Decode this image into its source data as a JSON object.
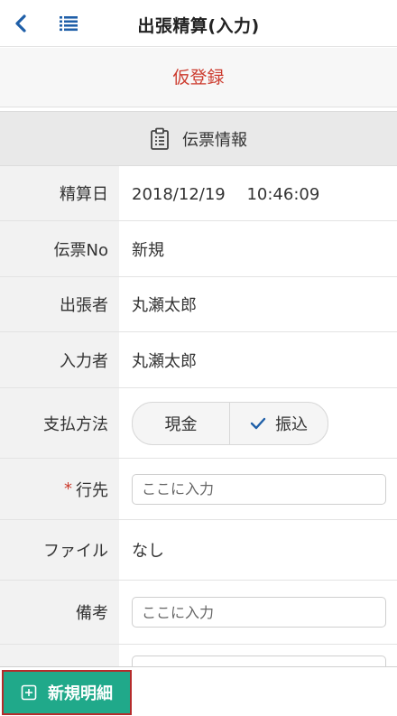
{
  "header": {
    "title": "出張精算(入力)",
    "back_icon": "chevron-left-icon",
    "menu_icon": "list-icon",
    "accent": "#1f5fa8"
  },
  "register_button": {
    "label": "仮登録",
    "color": "#cc3b2e"
  },
  "section": {
    "label": "伝票情報",
    "icon": "clipboard-icon"
  },
  "fields": {
    "settlement_date": {
      "label": "精算日",
      "value": "2018/12/19　 10:46:09"
    },
    "slip_no": {
      "label": "伝票No",
      "value": "新規"
    },
    "traveler": {
      "label": "出張者",
      "value": "丸瀬太郎"
    },
    "entered_by": {
      "label": "入力者",
      "value": "丸瀬太郎"
    },
    "payment_method": {
      "label": "支払方法",
      "options": [
        "現金",
        "振込"
      ],
      "selected": "振込"
    },
    "destination": {
      "required_mark": "*",
      "label": "行先",
      "placeholder": "ここに入力"
    },
    "file": {
      "label": "ファイル",
      "value": "なし"
    },
    "remarks": {
      "label": "備考",
      "placeholder": "ここに入力"
    }
  },
  "footer": {
    "new_detail_label": "新規明細",
    "button_color": "#20a98a"
  }
}
